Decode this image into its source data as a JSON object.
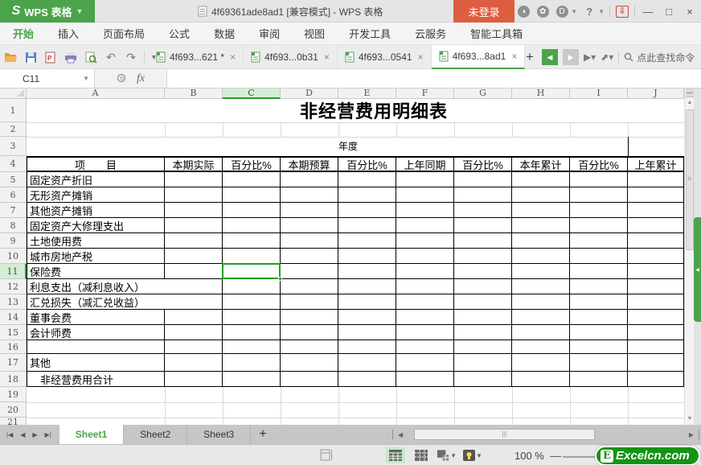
{
  "colors": {
    "accent_green": "#4ba34b",
    "selection_green": "#21a121",
    "login_red": "#dd5d41",
    "logo_green": "#149414"
  },
  "titlebar": {
    "logo_letter": "S",
    "app_name": "WPS 表格",
    "doc_title": "4f69361ade8ad1 [兼容模式] - WPS 表格",
    "login_label": "未登录"
  },
  "menubar": {
    "items": [
      "开始",
      "插入",
      "页面布局",
      "公式",
      "数据",
      "审阅",
      "视图",
      "开发工具",
      "云服务",
      "智能工具箱"
    ],
    "active_index": 0
  },
  "doc_tabs": {
    "tabs": [
      {
        "label": "4f693...621 *",
        "active": false
      },
      {
        "label": "4f693...0b31",
        "active": false
      },
      {
        "label": "4f693...0541",
        "active": false
      },
      {
        "label": "4f693...8ad1",
        "active": true
      }
    ],
    "add_label": "+",
    "search_label": "点此查找命令"
  },
  "formula_bar": {
    "name_box_value": "C11",
    "fx_label": "fx",
    "formula_value": ""
  },
  "sheet": {
    "title": "非经营费用明细表",
    "year_label": "年度",
    "columns": [
      "A",
      "B",
      "C",
      "D",
      "E",
      "F",
      "G",
      "H",
      "I",
      "J"
    ],
    "row_count": 21,
    "selected_cell": "C11",
    "selected_column": "C",
    "selected_row": 11,
    "header_row": [
      "项　　目",
      "本期实际",
      "百分比%",
      "本期预算",
      "百分比%",
      "上年同期",
      "百分比%",
      "本年累计",
      "百分比%",
      "上年累计"
    ],
    "items": [
      {
        "row": 5,
        "label": "固定资产折旧"
      },
      {
        "row": 6,
        "label": "无形资产摊销"
      },
      {
        "row": 7,
        "label": "其他资产摊销"
      },
      {
        "row": 8,
        "label": "固定资产大修理支出"
      },
      {
        "row": 9,
        "label": "土地使用费"
      },
      {
        "row": 10,
        "label": "城市房地产税"
      },
      {
        "row": 11,
        "label": "保险费"
      },
      {
        "row": 12,
        "label": "利息支出（减利息收入）",
        "overflow": true
      },
      {
        "row": 13,
        "label": "汇兑损失（减汇兑收益）",
        "overflow": true
      },
      {
        "row": 14,
        "label": "董事会费"
      },
      {
        "row": 15,
        "label": "会计师费"
      },
      {
        "row": 16,
        "label": ""
      },
      {
        "row": 17,
        "label": "其他"
      },
      {
        "row": 18,
        "label": "　非经营费用合计"
      }
    ]
  },
  "sheet_tabs": {
    "tabs": [
      "Sheet1",
      "Sheet2",
      "Sheet3"
    ],
    "active": "Sheet1",
    "add_label": "+"
  },
  "status_bar": {
    "zoom_level": "100 %",
    "watermark_letter": "E",
    "watermark_text": "Excelcn.com"
  }
}
